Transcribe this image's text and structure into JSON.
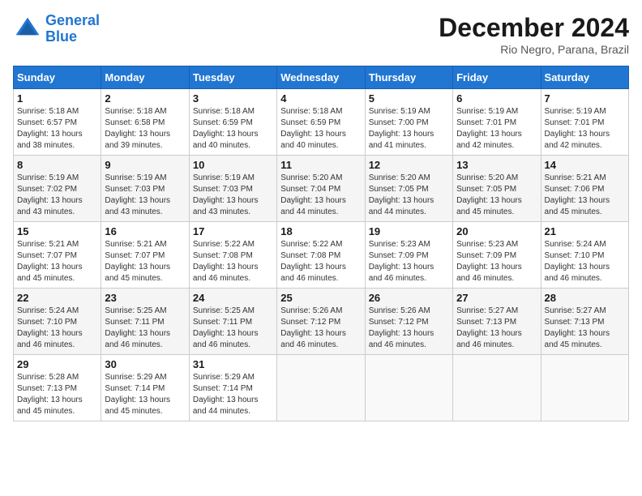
{
  "header": {
    "logo_line1": "General",
    "logo_line2": "Blue",
    "month": "December 2024",
    "location": "Rio Negro, Parana, Brazil"
  },
  "days_of_week": [
    "Sunday",
    "Monday",
    "Tuesday",
    "Wednesday",
    "Thursday",
    "Friday",
    "Saturday"
  ],
  "weeks": [
    [
      {
        "num": "1",
        "sunrise": "5:18 AM",
        "sunset": "6:57 PM",
        "daylight": "13 hours and 38 minutes."
      },
      {
        "num": "2",
        "sunrise": "5:18 AM",
        "sunset": "6:58 PM",
        "daylight": "13 hours and 39 minutes."
      },
      {
        "num": "3",
        "sunrise": "5:18 AM",
        "sunset": "6:59 PM",
        "daylight": "13 hours and 40 minutes."
      },
      {
        "num": "4",
        "sunrise": "5:18 AM",
        "sunset": "6:59 PM",
        "daylight": "13 hours and 40 minutes."
      },
      {
        "num": "5",
        "sunrise": "5:19 AM",
        "sunset": "7:00 PM",
        "daylight": "13 hours and 41 minutes."
      },
      {
        "num": "6",
        "sunrise": "5:19 AM",
        "sunset": "7:01 PM",
        "daylight": "13 hours and 42 minutes."
      },
      {
        "num": "7",
        "sunrise": "5:19 AM",
        "sunset": "7:01 PM",
        "daylight": "13 hours and 42 minutes."
      }
    ],
    [
      {
        "num": "8",
        "sunrise": "5:19 AM",
        "sunset": "7:02 PM",
        "daylight": "13 hours and 43 minutes."
      },
      {
        "num": "9",
        "sunrise": "5:19 AM",
        "sunset": "7:03 PM",
        "daylight": "13 hours and 43 minutes."
      },
      {
        "num": "10",
        "sunrise": "5:19 AM",
        "sunset": "7:03 PM",
        "daylight": "13 hours and 43 minutes."
      },
      {
        "num": "11",
        "sunrise": "5:20 AM",
        "sunset": "7:04 PM",
        "daylight": "13 hours and 44 minutes."
      },
      {
        "num": "12",
        "sunrise": "5:20 AM",
        "sunset": "7:05 PM",
        "daylight": "13 hours and 44 minutes."
      },
      {
        "num": "13",
        "sunrise": "5:20 AM",
        "sunset": "7:05 PM",
        "daylight": "13 hours and 45 minutes."
      },
      {
        "num": "14",
        "sunrise": "5:21 AM",
        "sunset": "7:06 PM",
        "daylight": "13 hours and 45 minutes."
      }
    ],
    [
      {
        "num": "15",
        "sunrise": "5:21 AM",
        "sunset": "7:07 PM",
        "daylight": "13 hours and 45 minutes."
      },
      {
        "num": "16",
        "sunrise": "5:21 AM",
        "sunset": "7:07 PM",
        "daylight": "13 hours and 45 minutes."
      },
      {
        "num": "17",
        "sunrise": "5:22 AM",
        "sunset": "7:08 PM",
        "daylight": "13 hours and 46 minutes."
      },
      {
        "num": "18",
        "sunrise": "5:22 AM",
        "sunset": "7:08 PM",
        "daylight": "13 hours and 46 minutes."
      },
      {
        "num": "19",
        "sunrise": "5:23 AM",
        "sunset": "7:09 PM",
        "daylight": "13 hours and 46 minutes."
      },
      {
        "num": "20",
        "sunrise": "5:23 AM",
        "sunset": "7:09 PM",
        "daylight": "13 hours and 46 minutes."
      },
      {
        "num": "21",
        "sunrise": "5:24 AM",
        "sunset": "7:10 PM",
        "daylight": "13 hours and 46 minutes."
      }
    ],
    [
      {
        "num": "22",
        "sunrise": "5:24 AM",
        "sunset": "7:10 PM",
        "daylight": "13 hours and 46 minutes."
      },
      {
        "num": "23",
        "sunrise": "5:25 AM",
        "sunset": "7:11 PM",
        "daylight": "13 hours and 46 minutes."
      },
      {
        "num": "24",
        "sunrise": "5:25 AM",
        "sunset": "7:11 PM",
        "daylight": "13 hours and 46 minutes."
      },
      {
        "num": "25",
        "sunrise": "5:26 AM",
        "sunset": "7:12 PM",
        "daylight": "13 hours and 46 minutes."
      },
      {
        "num": "26",
        "sunrise": "5:26 AM",
        "sunset": "7:12 PM",
        "daylight": "13 hours and 46 minutes."
      },
      {
        "num": "27",
        "sunrise": "5:27 AM",
        "sunset": "7:13 PM",
        "daylight": "13 hours and 46 minutes."
      },
      {
        "num": "28",
        "sunrise": "5:27 AM",
        "sunset": "7:13 PM",
        "daylight": "13 hours and 45 minutes."
      }
    ],
    [
      {
        "num": "29",
        "sunrise": "5:28 AM",
        "sunset": "7:13 PM",
        "daylight": "13 hours and 45 minutes."
      },
      {
        "num": "30",
        "sunrise": "5:29 AM",
        "sunset": "7:14 PM",
        "daylight": "13 hours and 45 minutes."
      },
      {
        "num": "31",
        "sunrise": "5:29 AM",
        "sunset": "7:14 PM",
        "daylight": "13 hours and 44 minutes."
      },
      null,
      null,
      null,
      null
    ]
  ]
}
